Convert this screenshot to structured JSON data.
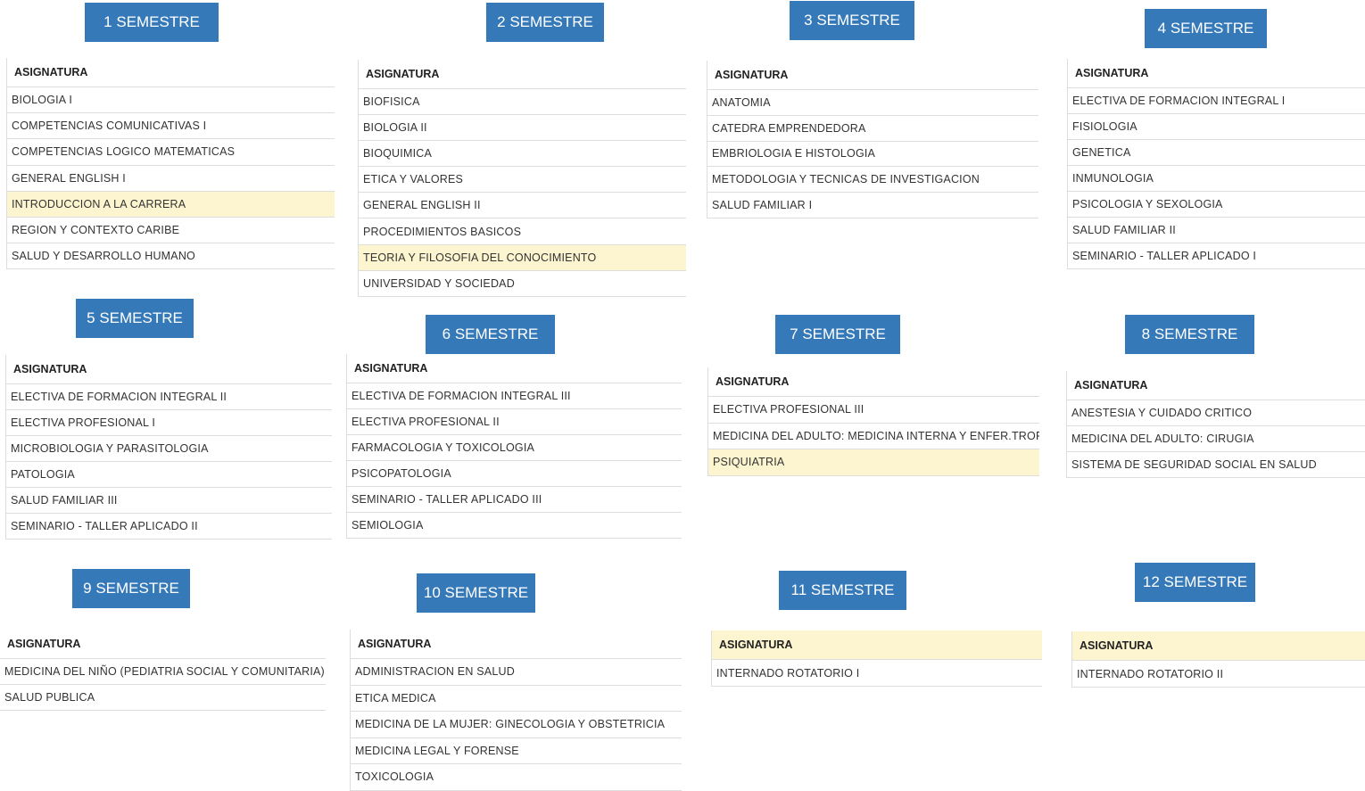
{
  "header_label": "ASIGNATURA",
  "colors": {
    "button": "#3679b9",
    "highlight": "#fdf5cf",
    "rule": "#dddddd"
  },
  "semesters": [
    {
      "title": "1 SEMESTRE",
      "subjects": [
        "BIOLOGIA I",
        "COMPETENCIAS COMUNICATIVAS I",
        "COMPETENCIAS LOGICO MATEMATICAS",
        "GENERAL ENGLISH I",
        "INTRODUCCION A LA CARRERA",
        "REGION Y CONTEXTO CARIBE",
        "SALUD Y DESARROLLO HUMANO"
      ],
      "highlighted": "INTRODUCCION A LA CARRERA"
    },
    {
      "title": "2 SEMESTRE",
      "subjects": [
        "BIOFISICA",
        "BIOLOGIA II",
        "BIOQUIMICA",
        "ETICA Y VALORES",
        "GENERAL ENGLISH II",
        "PROCEDIMIENTOS BASICOS",
        "TEORIA Y FILOSOFIA DEL CONOCIMIENTO",
        "UNIVERSIDAD Y SOCIEDAD"
      ],
      "highlighted": "TEORIA Y FILOSOFIA DEL CONOCIMIENTO"
    },
    {
      "title": "3 SEMESTRE",
      "subjects": [
        "ANATOMIA",
        "CATEDRA EMPRENDEDORA",
        "EMBRIOLOGIA E HISTOLOGIA",
        "METODOLOGIA Y TECNICAS DE INVESTIGACION",
        "SALUD FAMILIAR I"
      ]
    },
    {
      "title": "4 SEMESTRE",
      "subjects": [
        "ELECTIVA DE FORMACION INTEGRAL I",
        "FISIOLOGIA",
        "GENETICA",
        "INMUNOLOGIA",
        "PSICOLOGIA Y SEXOLOGIA",
        "SALUD FAMILIAR II",
        "SEMINARIO - TALLER APLICADO I"
      ]
    },
    {
      "title": "5 SEMESTRE",
      "subjects": [
        "ELECTIVA DE FORMACION INTEGRAL II",
        "ELECTIVA PROFESIONAL I",
        "MICROBIOLOGIA Y PARASITOLOGIA",
        "PATOLOGIA",
        "SALUD FAMILIAR III",
        "SEMINARIO - TALLER APLICADO II"
      ]
    },
    {
      "title": "6 SEMESTRE",
      "subjects": [
        "ELECTIVA DE FORMACION INTEGRAL III",
        "ELECTIVA PROFESIONAL II",
        "FARMACOLOGIA Y TOXICOLOGIA",
        "PSICOPATOLOGIA",
        "SEMINARIO - TALLER APLICADO III",
        "SEMIOLOGIA"
      ]
    },
    {
      "title": "7 SEMESTRE",
      "subjects": [
        "ELECTIVA PROFESIONAL III",
        "MEDICINA DEL ADULTO: MEDICINA INTERNA Y ENFER.TROP",
        "PSIQUIATRIA"
      ],
      "highlighted": "PSIQUIATRIA"
    },
    {
      "title": "8 SEMESTRE",
      "subjects": [
        "ANESTESIA Y CUIDADO CRITICO",
        "MEDICINA DEL ADULTO: CIRUGIA",
        "SISTEMA DE SEGURIDAD SOCIAL EN SALUD"
      ]
    },
    {
      "title": "9 SEMESTRE",
      "subjects": [
        "MEDICINA DEL NIÑO (PEDIATRIA SOCIAL Y COMUNITARIA)",
        "SALUD PUBLICA"
      ]
    },
    {
      "title": "10 SEMESTRE",
      "subjects": [
        "ADMINISTRACION EN SALUD",
        "ETICA MEDICA",
        "MEDICINA DE LA MUJER: GINECOLOGIA Y OBSTETRICIA",
        "MEDICINA LEGAL Y FORENSE",
        "TOXICOLOGIA"
      ]
    },
    {
      "title": "11 SEMESTRE",
      "subjects": [
        "INTERNADO ROTATORIO I"
      ],
      "header_highlighted": true
    },
    {
      "title": "12 SEMESTRE",
      "subjects": [
        "INTERNADO ROTATORIO II"
      ],
      "header_highlighted": true
    }
  ]
}
